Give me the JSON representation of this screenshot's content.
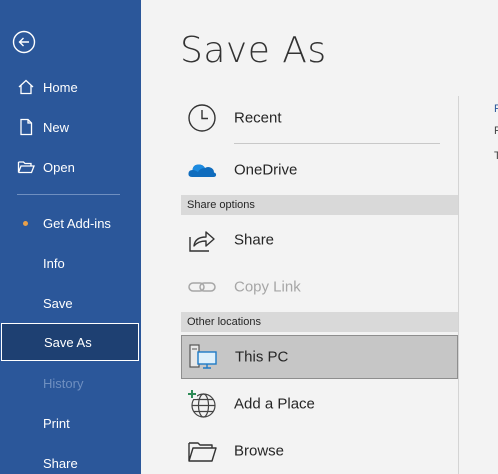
{
  "sidebar": {
    "items": [
      {
        "label": "Home"
      },
      {
        "label": "New"
      },
      {
        "label": "Open"
      },
      {
        "label": "Get Add-ins"
      },
      {
        "label": "Info"
      },
      {
        "label": "Save"
      },
      {
        "label": "Save As"
      },
      {
        "label": "History"
      },
      {
        "label": "Print"
      },
      {
        "label": "Share"
      }
    ]
  },
  "main": {
    "title": "Save As",
    "recent_label": "Recent",
    "onedrive_label": "OneDrive",
    "share_options_header": "Share options",
    "share_label": "Share",
    "copy_link_label": "Copy Link",
    "other_locations_header": "Other locations",
    "this_pc_label": "This PC",
    "add_place_label": "Add a Place",
    "browse_label": "Browse"
  },
  "colors": {
    "sidebar_bg": "#2b579a",
    "selected_bg": "#1e4072",
    "accent_dot": "#e8a04a",
    "onedrive_blue": "#0f6cbd"
  },
  "icons": [
    "back-arrow-icon",
    "home-icon",
    "new-document-icon",
    "open-folder-icon",
    "clock-icon",
    "onedrive-cloud-icon",
    "share-icon",
    "link-icon",
    "computer-icon",
    "globe-add-icon",
    "folder-icon"
  ]
}
